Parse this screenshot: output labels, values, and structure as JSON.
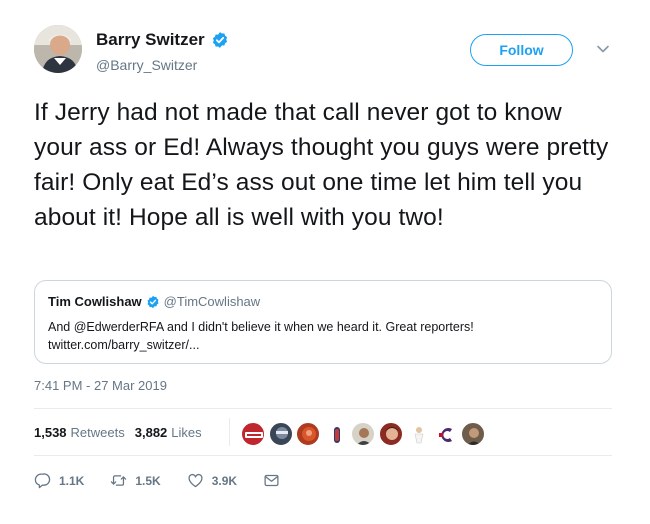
{
  "author": {
    "display_name": "Barry Switzer",
    "handle": "@Barry_Switzer",
    "verified": true,
    "follow_label": "Follow"
  },
  "tweet_text": "If Jerry had not made that call never got to know your ass or Ed! Always thought you guys were pretty fair! Only eat  Ed’s ass out one time let him tell you about it! Hope all is well with you two!",
  "quoted_tweet": {
    "display_name": "Tim Cowlishaw",
    "handle": "@TimCowlishaw",
    "verified": true,
    "text_line1": "And @EdwerderRFA and I didn't believe it when we heard it. Great reporters!",
    "text_line2": "twitter.com/barry_switzer/..."
  },
  "timestamp": "7:41 PM - 27 Mar 2019",
  "stats": {
    "retweets_count": "1,538",
    "retweets_label": "Retweets",
    "likes_count": "3,882",
    "likes_label": "Likes"
  },
  "actions": {
    "replies": "1.1K",
    "retweets": "1.5K",
    "likes": "3.9K"
  },
  "colors": {
    "accent": "#1da1f2",
    "secondary_text": "#657786",
    "divider": "#e6ecf0"
  },
  "icons": [
    "verified-badge-icon",
    "chevron-down-icon",
    "reply-icon",
    "retweet-icon",
    "like-heart-icon",
    "direct-message-icon"
  ]
}
